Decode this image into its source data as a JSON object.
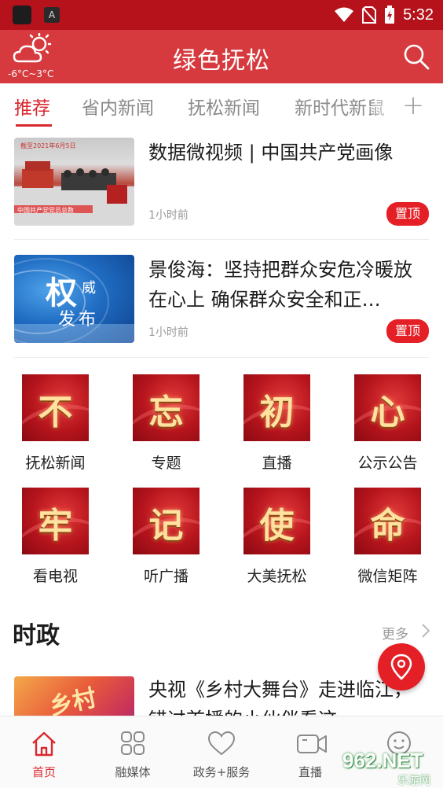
{
  "status_bar": {
    "time": "5:32",
    "app_badge": "A"
  },
  "header": {
    "title": "绿色抚松",
    "temperature": "-6°C~3°C"
  },
  "tabs": [
    {
      "label": "推荐",
      "active": true
    },
    {
      "label": "省内新闻",
      "active": false
    },
    {
      "label": "抚松新闻",
      "active": false
    },
    {
      "label": "新时代新鼠",
      "active": false
    }
  ],
  "news": [
    {
      "headline": "数据微视频 | 中国共产党画像",
      "time": "1小时前",
      "badge": "置顶",
      "thumb_caption": "中国共产党党员总数",
      "thumb_date": "截至2021年6月5日"
    },
    {
      "headline": "景俊海：坚持把群众安危冷暖放在心上 确保群众安全和正…",
      "time": "1小时前",
      "badge": "置顶",
      "thumb_big": "权",
      "thumb_small1": "威",
      "thumb_small2": "发布"
    }
  ],
  "grid": [
    {
      "char": "不",
      "label": "抚松新闻"
    },
    {
      "char": "忘",
      "label": "专题"
    },
    {
      "char": "初",
      "label": "直播"
    },
    {
      "char": "心",
      "label": "公示公告"
    },
    {
      "char": "牢",
      "label": "看电视"
    },
    {
      "char": "记",
      "label": "听广播"
    },
    {
      "char": "使",
      "label": "大美抚松"
    },
    {
      "char": "命",
      "label": "微信矩阵"
    }
  ],
  "section": {
    "title": "时政",
    "more": "更多"
  },
  "section_news": {
    "headline": "央视《乡村大舞台》走进临江，错过首播的小伙伴看这"
  },
  "bottom_nav": [
    {
      "label": "首页",
      "active": true
    },
    {
      "label": "融媒体",
      "active": false
    },
    {
      "label": "政务+服务",
      "active": false
    },
    {
      "label": "直播",
      "active": false
    },
    {
      "label": "",
      "active": false
    }
  ],
  "watermark": {
    "text": "962.NET",
    "sub": "乐游网"
  },
  "colors": {
    "header": "#d73a3e",
    "status_bar": "#b5121b",
    "accent": "#d9282f",
    "badge": "#e41f26"
  }
}
